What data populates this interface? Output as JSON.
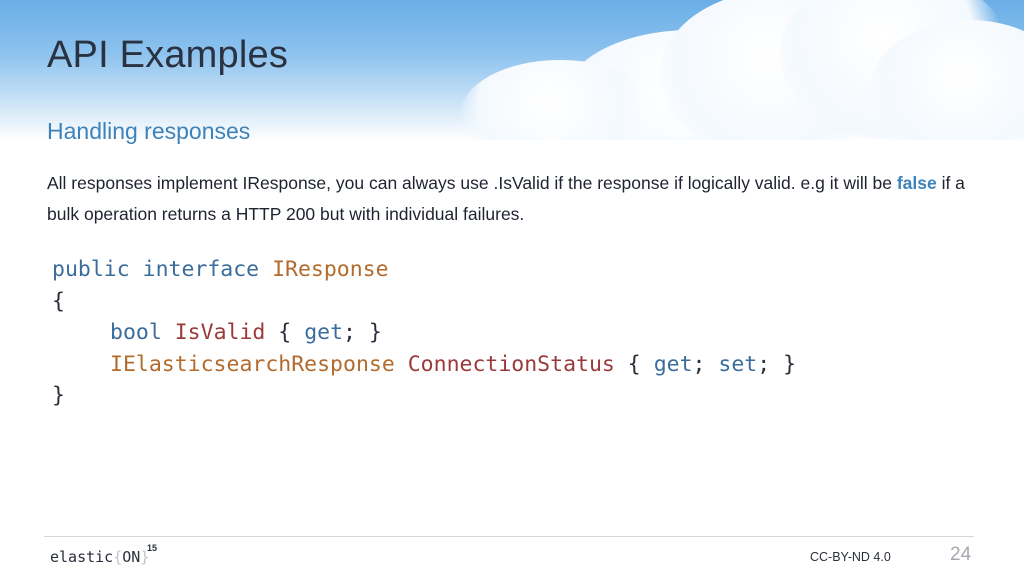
{
  "slide": {
    "title": "API Examples",
    "subtitle": "Handling responses",
    "description": {
      "before": "All responses implement IResponse, you can always use .IsValid if the response if logically valid. e.g it will be ",
      "highlight": "false",
      "after": " if a bulk operation returns a HTTP 200 but with individual failures."
    },
    "code": {
      "l1_kw1": "public",
      "l1_sp1": " ",
      "l1_kw2": "interface",
      "l1_sp2": " ",
      "l1_type": "IResponse",
      "l2": "{",
      "l3_type": "bool",
      "l3_sp": " ",
      "l3_member": "IsValid",
      "l3_open": " { ",
      "l3_get": "get",
      "l3_close": "; }",
      "l4_type": "IElasticsearchResponse",
      "l4_sp": " ",
      "l4_member": "ConnectionStatus",
      "l4_open": " { ",
      "l4_get": "get",
      "l4_semi": "; ",
      "l4_set": "set",
      "l4_close": "; }",
      "l5": "}"
    }
  },
  "footer": {
    "logo_text": "elastic",
    "logo_brace_open": "{",
    "logo_on": "ON",
    "logo_brace_close": "}",
    "logo_sup": "15",
    "license": "CC-BY-ND 4.0",
    "page_number": "24"
  },
  "colors": {
    "accent": "#3d82b9",
    "keyword": "#3b6d9c",
    "type": "#b36b2d",
    "member": "#9a3a3a",
    "sky_top": "#6aaee6"
  }
}
